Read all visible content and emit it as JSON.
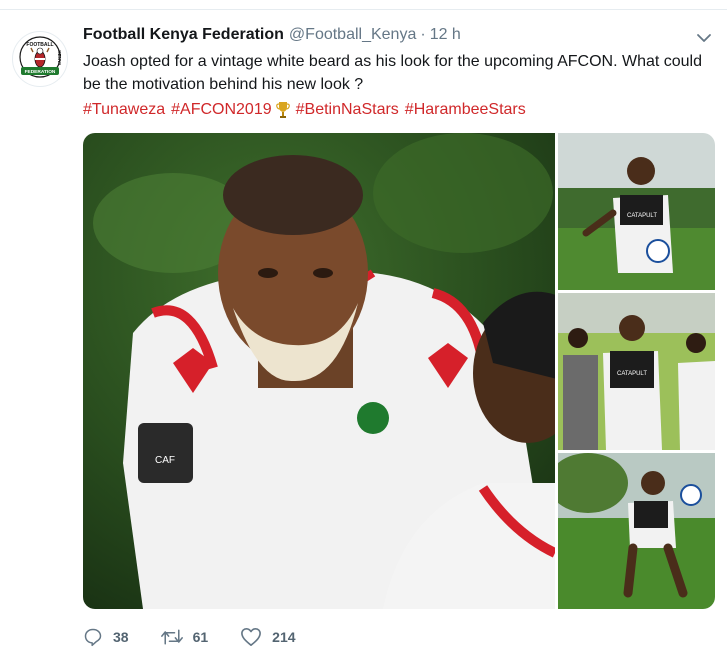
{
  "tweet": {
    "author_name": "Football Kenya Federation",
    "handle": "@Football_Kenya",
    "separator": "·",
    "time": "12 h",
    "text": "Joash opted for a vintage white beard as his look for the upcoming AFCON. What could be the motivation behind his new look ?",
    "hashtags": [
      "#Tunaweza",
      "#AFCON2019",
      "#BetinNaStars",
      "#HarambeeStars"
    ],
    "logo": {
      "top_text": "FOOTBALL",
      "side_text": "KENYA",
      "ribbon_text": "FEDERATION"
    },
    "jersey_sponsor": "CATAPULT",
    "actions": {
      "reply_count": "38",
      "retweet_count": "61",
      "like_count": "214"
    },
    "icons": {
      "more": "chevron-down-icon",
      "reply": "reply-icon",
      "retweet": "retweet-icon",
      "like": "heart-icon",
      "emoji": "trophy-icon"
    },
    "colors": {
      "hashtag": "#d0282a",
      "secondary_text": "#657786",
      "name": "#14171a"
    }
  }
}
